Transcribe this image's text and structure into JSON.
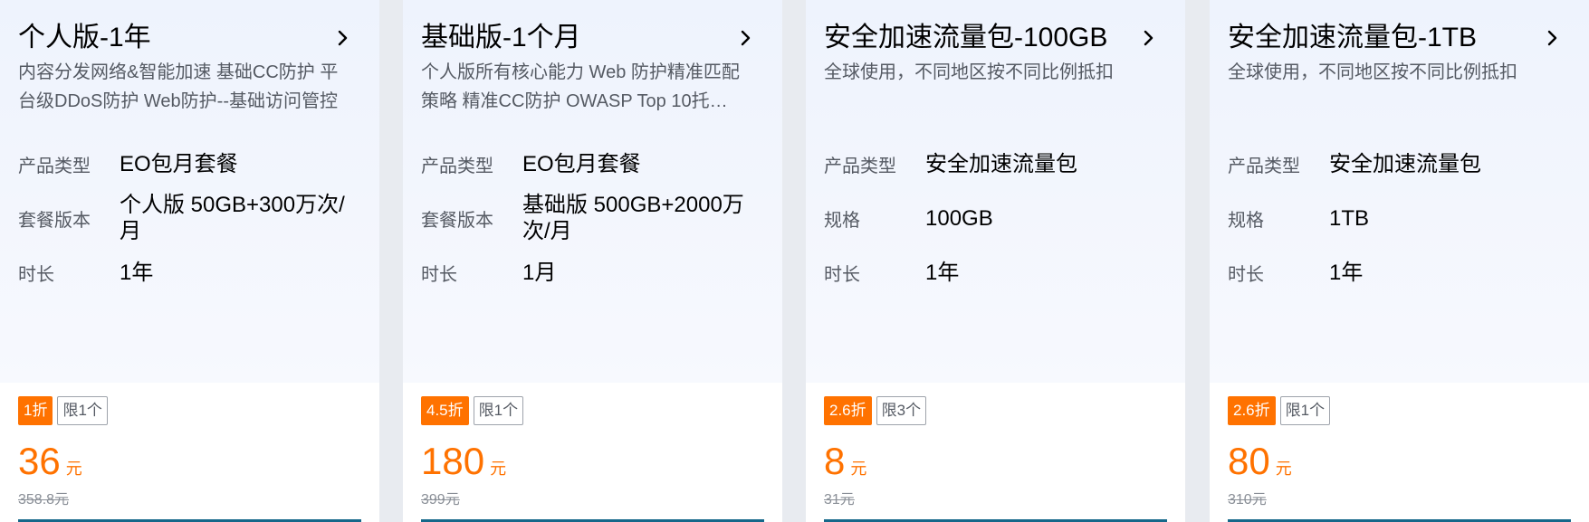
{
  "cards": [
    {
      "title": "个人版-1年",
      "description": "内容分发网络&智能加速 基础CC防护 平台级DDoS防护 Web防护--基础访问管控",
      "specs": [
        {
          "label": "产品类型",
          "value": "EO包月套餐"
        },
        {
          "label": "套餐版本",
          "value": "个人版 50GB+300万次/月"
        },
        {
          "label": "时长",
          "value": "1年"
        }
      ],
      "discount": "1折",
      "limit": "限1个",
      "price": "36",
      "price_unit": "元",
      "original_price": "358.8元"
    },
    {
      "title": "基础版-1个月",
      "description": "个人版所有核心能力 Web 防护精准匹配策略 精准CC防护 OWASP Top 10托…",
      "specs": [
        {
          "label": "产品类型",
          "value": "EO包月套餐"
        },
        {
          "label": "套餐版本",
          "value": "基础版 500GB+2000万次/月"
        },
        {
          "label": "时长",
          "value": "1月"
        }
      ],
      "discount": "4.5折",
      "limit": "限1个",
      "price": "180",
      "price_unit": "元",
      "original_price": "399元"
    },
    {
      "title": "安全加速流量包-100GB",
      "description": "全球使用，不同地区按不同比例抵扣",
      "specs": [
        {
          "label": "产品类型",
          "value": "安全加速流量包"
        },
        {
          "label": "规格",
          "value": "100GB"
        },
        {
          "label": "时长",
          "value": "1年"
        }
      ],
      "discount": "2.6折",
      "limit": "限3个",
      "price": "8",
      "price_unit": "元",
      "original_price": "31元"
    },
    {
      "title": "安全加速流量包-1TB",
      "description": "全球使用，不同地区按不同比例抵扣",
      "specs": [
        {
          "label": "产品类型",
          "value": "安全加速流量包"
        },
        {
          "label": "规格",
          "value": "1TB"
        },
        {
          "label": "时长",
          "value": "1年"
        }
      ],
      "discount": "2.6折",
      "limit": "限1个",
      "price": "80",
      "price_unit": "元",
      "original_price": "310元"
    }
  ],
  "colors": {
    "accent": "#ff7200",
    "card_top_bg": "#eef3fd",
    "page_bg": "#e8ebf0",
    "label_gray": "#555a63",
    "button_teal": "#15688a"
  },
  "icons": {
    "chevron": "chevron-right-icon"
  }
}
